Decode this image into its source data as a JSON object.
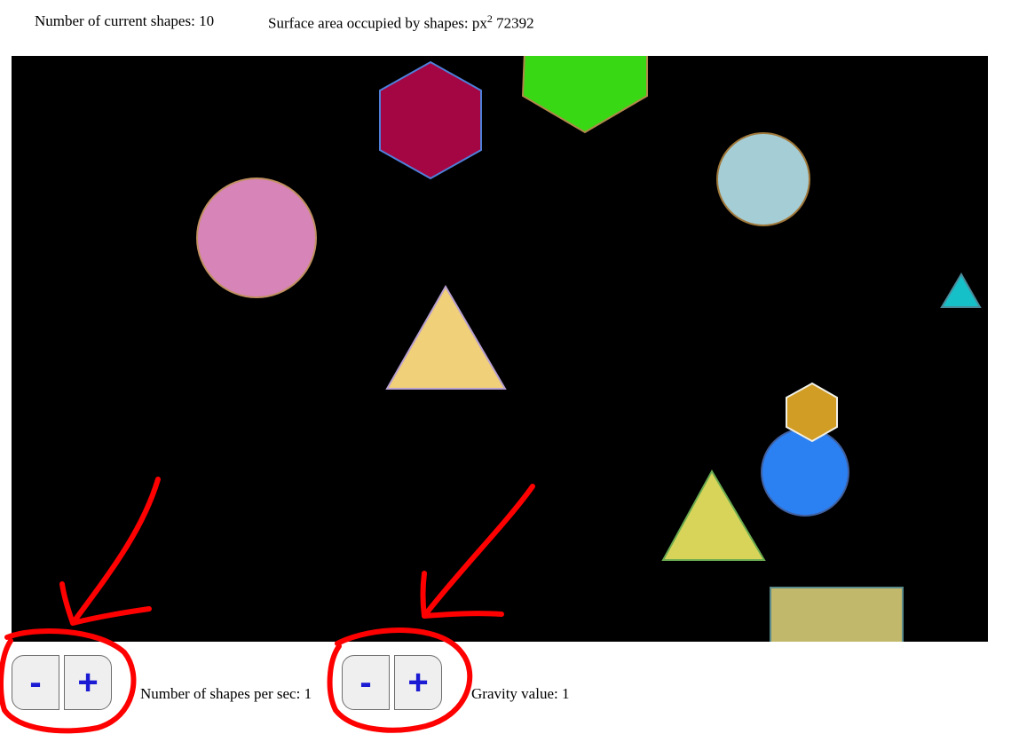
{
  "stats": {
    "shape_count_label": "Number of current shapes:",
    "shape_count": "10",
    "area_label": "Surface area occupied by shapes: px",
    "area_exponent": "2",
    "area_value": "72392"
  },
  "controls": {
    "shapes_per_sec": {
      "decrease_label": "-",
      "increase_label": "+",
      "label": "Number of shapes per sec:",
      "value": "1"
    },
    "gravity": {
      "decrease_label": "-",
      "increase_label": "+",
      "label": "Gravity value:",
      "value": "1"
    }
  },
  "canvas": {
    "background": "#000000",
    "shapes": [
      {
        "kind": "hexagon",
        "fill": "#a30642",
        "stroke": "#4f7fd9"
      },
      {
        "kind": "pentagon",
        "fill": "#38d914",
        "stroke": "#b08a4a"
      },
      {
        "kind": "circle",
        "fill": "#a5cdd6",
        "stroke": "#a0783a"
      },
      {
        "kind": "circle",
        "fill": "#d784b8",
        "stroke": "#c09060"
      },
      {
        "kind": "triangle",
        "fill": "#f0d078",
        "stroke": "#b8a0d0"
      },
      {
        "kind": "triangle",
        "fill": "#16c0c8",
        "stroke": "#4a8a9a"
      },
      {
        "kind": "hexagon",
        "fill": "#d19d24",
        "stroke": "#f0f0e8"
      },
      {
        "kind": "circle",
        "fill": "#2b80f2",
        "stroke": "#4060a0"
      },
      {
        "kind": "triangle",
        "fill": "#d8d45a",
        "stroke": "#6aaa50"
      },
      {
        "kind": "rectangle",
        "fill": "#c2b86c",
        "stroke": "#5a8a8a"
      }
    ]
  },
  "annotation_color": "#ff0000"
}
